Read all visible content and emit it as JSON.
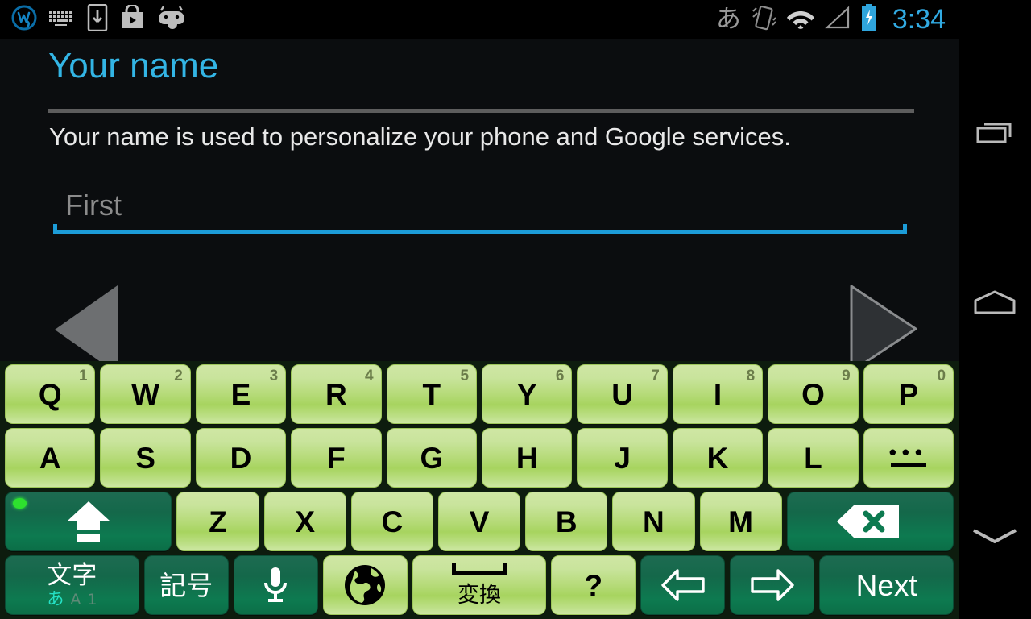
{
  "status_bar": {
    "left_icons": [
      {
        "name": "wordpress-logo-icon",
        "glyph": "W"
      },
      {
        "name": "keyboard-icon",
        "glyph": "keyboard"
      },
      {
        "name": "download-to-device-icon",
        "glyph": "download"
      },
      {
        "name": "play-store-icon",
        "glyph": "play-bag"
      },
      {
        "name": "android-head-icon",
        "glyph": "android"
      }
    ],
    "ime_indicator": "あ",
    "right_icons": [
      {
        "name": "vibrate-icon"
      },
      {
        "name": "wifi-icon"
      },
      {
        "name": "cell-signal-icon"
      },
      {
        "name": "battery-charging-icon"
      }
    ],
    "time": "3:34",
    "time_color": "#31aae2"
  },
  "content": {
    "title": "Your name",
    "title_color": "#33b5e5",
    "description": "Your name is used to personalize your phone and Google services.",
    "name_field": {
      "value": "",
      "placeholder": "First",
      "underline_color": "#1c9cd8"
    },
    "prev_button": "back-triangle",
    "next_button": "forward-triangle"
  },
  "keyboard": {
    "bg_color": "#0d1c0e",
    "key_light_color": "#b4da76",
    "key_dark_color": "#0d7a50",
    "row1": [
      {
        "label": "Q",
        "sup": "1"
      },
      {
        "label": "W",
        "sup": "2"
      },
      {
        "label": "E",
        "sup": "3"
      },
      {
        "label": "R",
        "sup": "4"
      },
      {
        "label": "T",
        "sup": "5"
      },
      {
        "label": "Y",
        "sup": "6"
      },
      {
        "label": "U",
        "sup": "7"
      },
      {
        "label": "I",
        "sup": "8"
      },
      {
        "label": "O",
        "sup": "9"
      },
      {
        "label": "P",
        "sup": "0"
      }
    ],
    "row2": [
      {
        "label": "A"
      },
      {
        "label": "S"
      },
      {
        "label": "D"
      },
      {
        "label": "F"
      },
      {
        "label": "G"
      },
      {
        "label": "H"
      },
      {
        "label": "J"
      },
      {
        "label": "K"
      },
      {
        "label": "L"
      },
      {
        "label": "…—",
        "name": "dash-dots-key"
      }
    ],
    "row3": [
      {
        "label": "Z"
      },
      {
        "label": "X"
      },
      {
        "label": "C"
      },
      {
        "label": "V"
      },
      {
        "label": "B"
      },
      {
        "label": "N"
      },
      {
        "label": "M"
      }
    ],
    "shift_key": {
      "name": "shift-key",
      "led_on": true
    },
    "backspace_key": {
      "name": "backspace-key"
    },
    "row4": {
      "moji": {
        "main": "文字",
        "sub_on": "あ",
        "sub_off_a": "A",
        "sub_off_1": "1"
      },
      "kigou": "記号",
      "mic": "microphone-key",
      "globe": "language-switch-key",
      "space": {
        "label": "変換"
      },
      "question": "?",
      "arrow_left": "cursor-left-key",
      "arrow_right": "cursor-right-key",
      "next": "Next"
    }
  },
  "navbar": {
    "recent_apps": "recent-apps",
    "home": "home",
    "hide_keyboard": "hide-keyboard"
  }
}
